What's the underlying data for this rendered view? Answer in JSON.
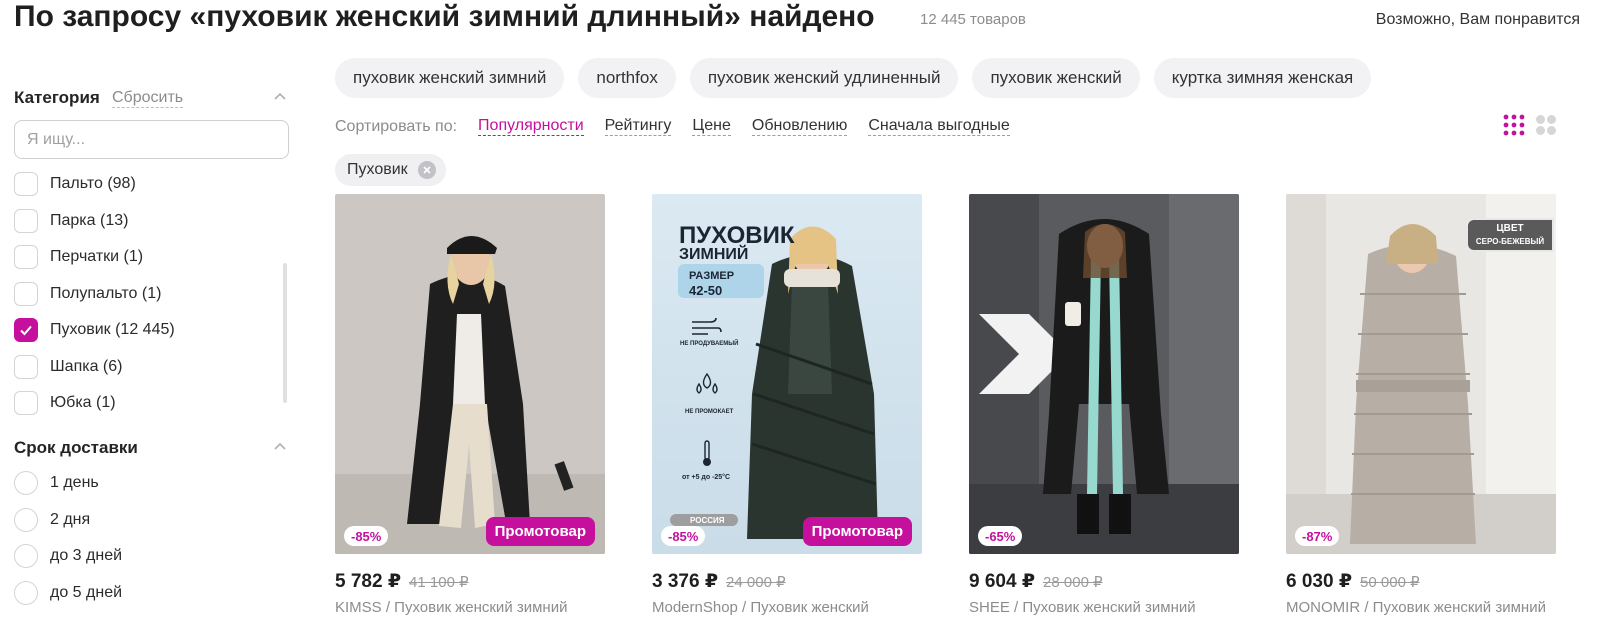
{
  "header": {
    "title": "По запросу «пуховик женский зимний длинный» найдено",
    "count": "12 445 товаров",
    "recommendation": "Возможно, Вам понравится"
  },
  "sidebar": {
    "category": {
      "title": "Категория",
      "reset": "Сбросить",
      "search_placeholder": "Я ищу...",
      "options": [
        {
          "label": "Пальто (98)",
          "checked": false
        },
        {
          "label": "Парка (13)",
          "checked": false
        },
        {
          "label": "Перчатки (1)",
          "checked": false
        },
        {
          "label": "Полупальто (1)",
          "checked": false
        },
        {
          "label": "Пуховик (12 445)",
          "checked": true
        },
        {
          "label": "Шапка (6)",
          "checked": false
        },
        {
          "label": "Юбка (1)",
          "checked": false
        }
      ]
    },
    "delivery": {
      "title": "Срок доставки",
      "options": [
        {
          "label": "1 день"
        },
        {
          "label": "2 дня"
        },
        {
          "label": "до 3 дней"
        },
        {
          "label": "до 5 дней"
        }
      ]
    }
  },
  "chips": [
    "пуховик женский зимний",
    "northfox",
    "пуховик женский удлиненный",
    "пуховик женский",
    "куртка зимняя женская"
  ],
  "sort": {
    "label": "Сортировать по:",
    "options": [
      "Популярности",
      "Рейтингу",
      "Цене",
      "Обновлению",
      "Сначала выгодные"
    ],
    "active": "Популярности"
  },
  "active_filter": "Пуховик",
  "products": [
    {
      "discount": "-85%",
      "promo": "Промотовар",
      "price": "5 782 ₽",
      "old_price": "41 100 ₽",
      "name": "KIMSS / Пуховик женский зимний"
    },
    {
      "discount": "-85%",
      "promo": "Промотовар",
      "price": "3 376 ₽",
      "old_price": "24 000 ₽",
      "name": "ModernShop / Пуховик женский",
      "image_text": {
        "title1": "ПУХОВИК",
        "title2": "ЗИМНИЙ",
        "size_label": "РАЗМЕР",
        "size_value": "42-50",
        "feat1": "НЕ ПРОДУВАЕМЫЙ",
        "feat2": "НЕ ПРОМОКАЕТ",
        "feat3": "от +5 до -25°С",
        "country": "РОССИЯ"
      }
    },
    {
      "discount": "-65%",
      "promo": "",
      "price": "9 604 ₽",
      "old_price": "28 000 ₽",
      "name": "SHEE / Пуховик женский зимний"
    },
    {
      "discount": "-87%",
      "promo": "",
      "price": "6 030 ₽",
      "old_price": "50 000 ₽",
      "name": "MONOMIR / Пуховик женский зимний",
      "image_text": {
        "badge1": "ЦВЕТ",
        "badge2": "СЕРО-БЕЖЕВЫЙ"
      }
    }
  ],
  "colors": {
    "accent": "#c5109d",
    "chip_bg": "#f2f2f4",
    "muted": "#8c8c8c"
  }
}
